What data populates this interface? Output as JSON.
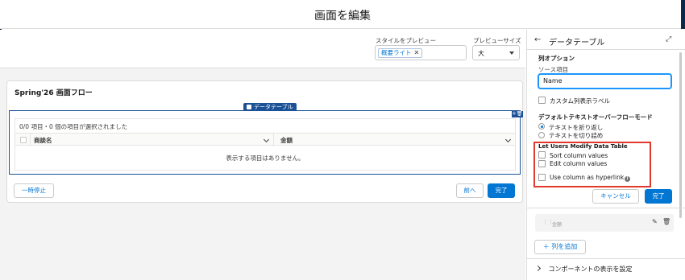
{
  "header": {
    "title": "画面を編集"
  },
  "preview": {
    "style_label": "スタイルをプレビュー",
    "style_value": "概要ライト",
    "size_label": "プレビューサイズ",
    "size_value": "大"
  },
  "flow": {
    "title": "Spring'26 画面フロー",
    "component_tag": "データテーブル",
    "table": {
      "count_text": "0/0 項目・0 個の項目が選択されました",
      "columns": [
        "商談名",
        "金額"
      ],
      "empty_text": "表示する項目はありません。"
    },
    "buttons": {
      "pause": "一時停止",
      "previous": "前へ",
      "finish": "完了"
    }
  },
  "panel": {
    "title": "データテーブル",
    "section_title": "列オプション",
    "source_label": "ソース項目",
    "source_value": "Name",
    "custom_label": "カスタム列表示ラベル",
    "overflow_title": "デフォルトテキストオーバーフローモード",
    "overflow_options": [
      "テキストを折り返し",
      "テキストを切り詰め"
    ],
    "overflow_selected": 0,
    "modify_title": "Let Users Modify Data Table",
    "sort_label": "Sort column values",
    "edit_label": "Edit column values",
    "hyperlink_label": "Use column as hyperlink",
    "cancel": "キャンセル",
    "done": "完了",
    "column_item": "金額",
    "add_column": "列を追加",
    "component_visibility": "コンポーネントの表示を設定"
  },
  "colors": {
    "brand": "#0176d3",
    "highlight": "#e0382c",
    "component_frame": "#1b5297"
  }
}
